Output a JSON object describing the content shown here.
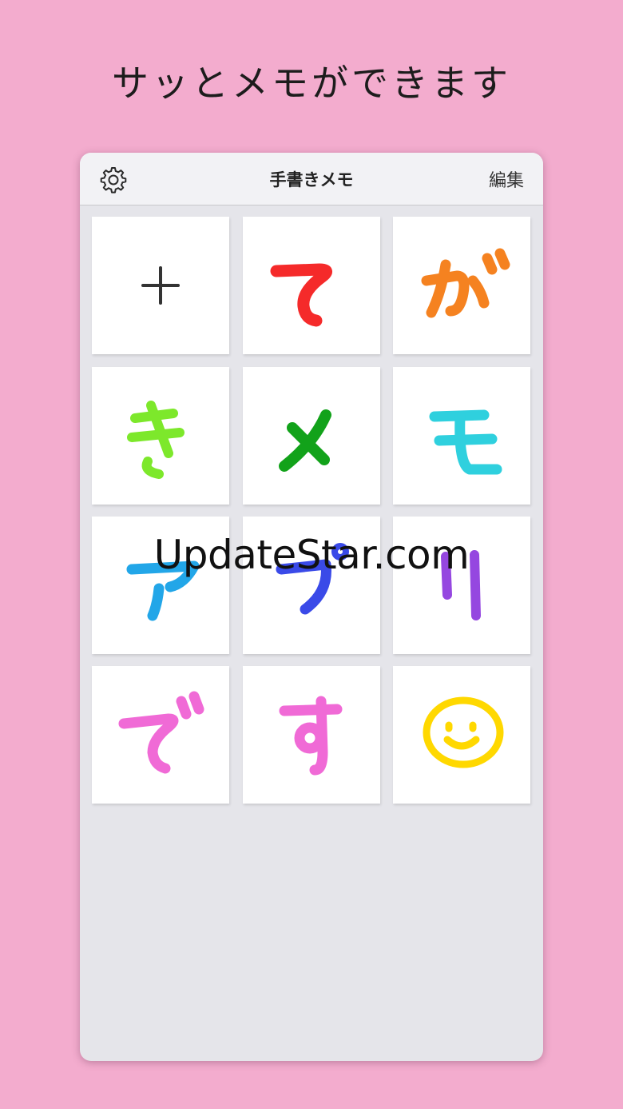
{
  "headline": "サッとメモができます",
  "navbar": {
    "title": "手書きメモ",
    "edit_label": "編集",
    "settings_icon": "gear-icon"
  },
  "memos": [
    {
      "label": "+",
      "color": "#333333",
      "kind": "add"
    },
    {
      "label": "て",
      "color": "#f52a2a",
      "kind": "memo"
    },
    {
      "label": "が",
      "color": "#f58220",
      "kind": "memo"
    },
    {
      "label": "き",
      "color": "#7de82b",
      "kind": "memo"
    },
    {
      "label": "メ",
      "color": "#12a21a",
      "kind": "memo"
    },
    {
      "label": "モ",
      "color": "#2fd0de",
      "kind": "memo"
    },
    {
      "label": "ア",
      "color": "#22a6e8",
      "kind": "memo"
    },
    {
      "label": "プ",
      "color": "#3a4ae8",
      "kind": "memo"
    },
    {
      "label": "リ",
      "color": "#9547e0",
      "kind": "memo"
    },
    {
      "label": "で",
      "color": "#f06ad6",
      "kind": "memo"
    },
    {
      "label": "す",
      "color": "#f06ad6",
      "kind": "memo"
    },
    {
      "label": "smiley",
      "color": "#ffd800",
      "kind": "memo"
    }
  ],
  "watermark": "UpdateStar.com"
}
